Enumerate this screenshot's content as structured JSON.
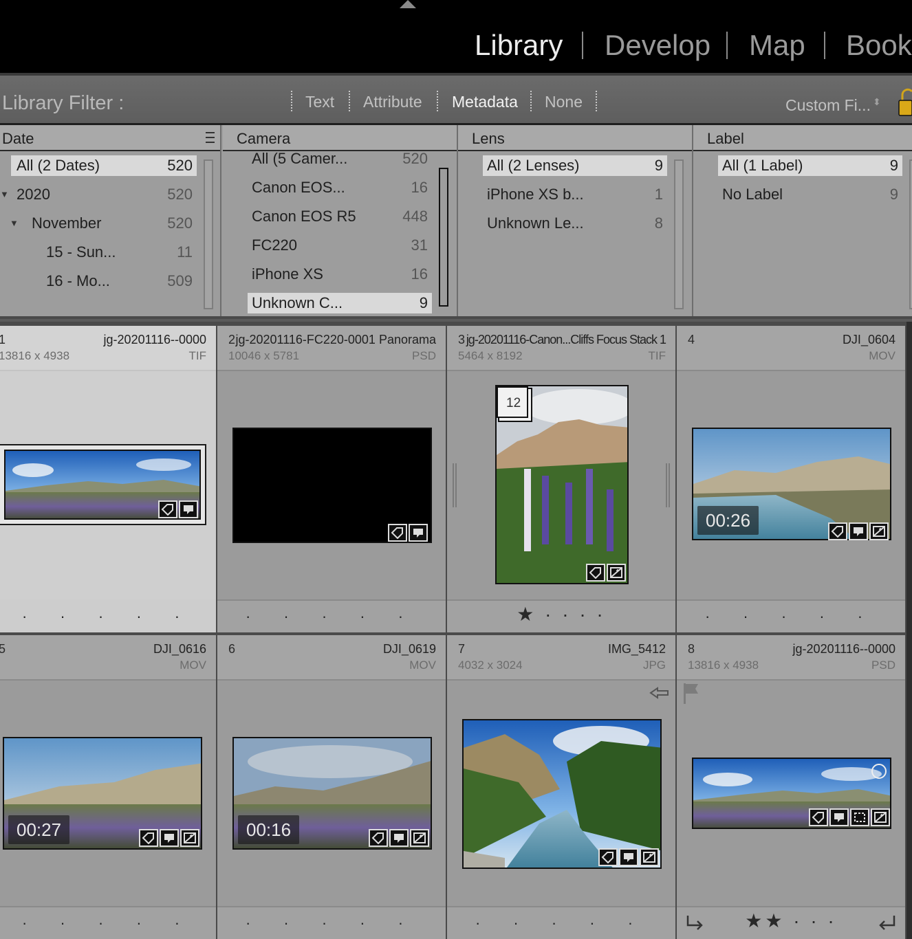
{
  "modules": [
    "Library",
    "Develop",
    "Map",
    "Book"
  ],
  "filter_bar": {
    "title": "Library Filter :",
    "tabs": [
      "Text",
      "Attribute",
      "Metadata",
      "None"
    ],
    "active_tab": "Metadata",
    "custom_filter": "Custom Fi...",
    "custom_filter_arrows": "⬍"
  },
  "metadata_columns": [
    {
      "header": "Date",
      "rows": [
        {
          "label": "All (2 Dates)",
          "count": "520"
        },
        {
          "label": "2020",
          "count": "520"
        },
        {
          "label": "November",
          "count": "520"
        },
        {
          "label": "15 - Sun...",
          "count": "11"
        },
        {
          "label": "16 - Mo...",
          "count": "509"
        }
      ]
    },
    {
      "header": "Camera",
      "rows": [
        {
          "label": "All (5 Camer...",
          "count": "520"
        },
        {
          "label": "Canon EOS...",
          "count": "16"
        },
        {
          "label": "Canon EOS R5",
          "count": "448"
        },
        {
          "label": "FC220",
          "count": "31"
        },
        {
          "label": "iPhone XS",
          "count": "16"
        },
        {
          "label": "Unknown C...",
          "count": "9"
        }
      ]
    },
    {
      "header": "Lens",
      "rows": [
        {
          "label": "All (2 Lenses)",
          "count": "9"
        },
        {
          "label": "iPhone XS b...",
          "count": "1"
        },
        {
          "label": "Unknown Le...",
          "count": "8"
        }
      ]
    },
    {
      "header": "Label",
      "rows": [
        {
          "label": "All (1 Label)",
          "count": "9"
        },
        {
          "label": "No Label",
          "count": "9"
        }
      ]
    }
  ],
  "grid": [
    {
      "index": "1",
      "name": "jg-20201116--0000",
      "dims": "13816 x 4938",
      "ext": "TIF",
      "rating": "· · · · ·"
    },
    {
      "index": "2",
      "name": "jg-20201116-FC220-0001 Panorama",
      "dims": "10046 x 5781",
      "ext": "PSD",
      "rating": "· · · · ·"
    },
    {
      "index": "3",
      "name": "jg-20201116-Canon...Cliffs Focus Stack 1",
      "dims": "5464 x 8192",
      "ext": "TIF",
      "rating": "★ · · · ·",
      "stack_count": "12"
    },
    {
      "index": "4",
      "name": "DJI_0604",
      "dims": "",
      "ext": "MOV",
      "rating": "· · · · ·",
      "duration": "00:26"
    },
    {
      "index": "5",
      "name": "DJI_0616",
      "dims": "",
      "ext": "MOV",
      "rating": "· · · · ·",
      "duration": "00:27"
    },
    {
      "index": "6",
      "name": "DJI_0619",
      "dims": "",
      "ext": "MOV",
      "rating": "· · · · ·",
      "duration": "00:16"
    },
    {
      "index": "7",
      "name": "IMG_5412",
      "dims": "4032 x 3024",
      "ext": "JPG",
      "rating": "· · · · ·"
    },
    {
      "index": "8",
      "name": "jg-20201116--0000",
      "dims": "13816 x 4938",
      "ext": "PSD",
      "rating": "★★ · · ·"
    }
  ]
}
